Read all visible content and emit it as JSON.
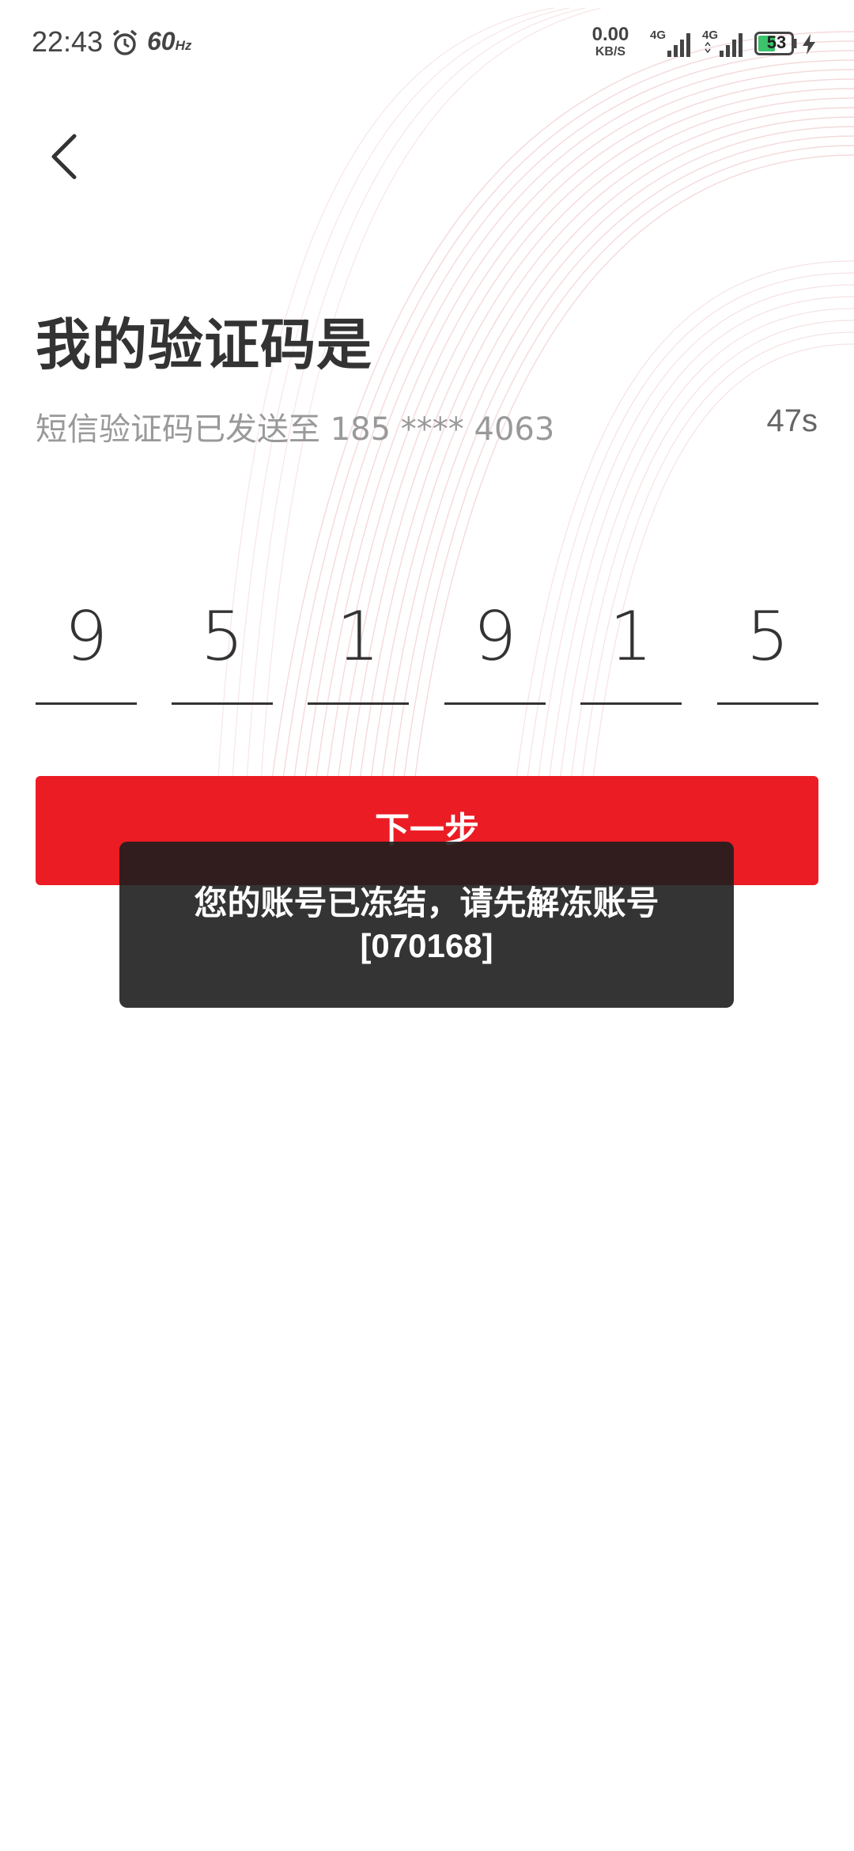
{
  "status_bar": {
    "time": "22:43",
    "alarm_icon": "alarm-clock-icon",
    "refresh_rate_value": "60",
    "refresh_rate_unit": "Hz",
    "net_speed_value": "0.00",
    "net_speed_unit": "KB/S",
    "signal_1_label": "4G",
    "signal_2_label": "4G",
    "battery_level": "53",
    "battery_charging": true
  },
  "header": {
    "back_icon": "chevron-left-icon"
  },
  "main": {
    "title": "我的验证码是",
    "sms_hint": "短信验证码已发送至 185 **** 4063",
    "countdown": "47s",
    "code_digits": [
      "9",
      "5",
      "1",
      "9",
      "1",
      "5"
    ],
    "next_button_label": "下一步"
  },
  "toast": {
    "line1": "您的账号已冻结，请先解冻账号",
    "line2": "[070168]"
  },
  "colors": {
    "accent_red": "#ec1c24",
    "title_text": "#333333",
    "hint_text": "#999999",
    "toast_bg": "#1e1e1e"
  }
}
